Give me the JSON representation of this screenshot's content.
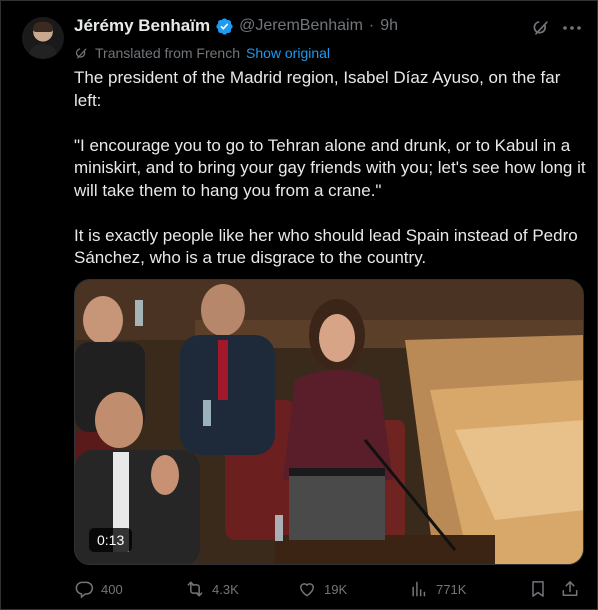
{
  "tweet": {
    "author_name": "Jérémy Benhaïm",
    "handle": "@JeremBenhaim",
    "separator": "·",
    "time": "9h",
    "translated_label": "Translated from French",
    "show_original": "Show original",
    "paragraphs": [
      "The president of the Madrid region, Isabel Díaz Ayuso, on the far left:",
      "\"I encourage you to go to Tehran alone and drunk, or to Kabul in a miniskirt, and to bring your gay friends with you; let's see how long it will take them to hang you from a crane.\"",
      "It is exactly people like her who should lead Spain instead of Pedro Sánchez, who is a true disgrace to the country."
    ]
  },
  "media": {
    "duration": "0:13"
  },
  "actions": {
    "replies": "400",
    "reposts": "4.3K",
    "likes": "19K",
    "views": "771K"
  },
  "icons": {
    "verified": "verified-badge-icon",
    "grok": "grok-icon",
    "more": "more-icon",
    "translate": "translate-icon",
    "reply": "reply-icon",
    "repost": "repost-icon",
    "like": "heart-icon",
    "views": "views-icon",
    "bookmark": "bookmark-icon",
    "share": "share-icon"
  },
  "colors": {
    "background": "#000000",
    "text": "#e7e9ea",
    "muted": "#71767b",
    "link": "#1d9bf0",
    "verified": "#1d9bf0"
  }
}
